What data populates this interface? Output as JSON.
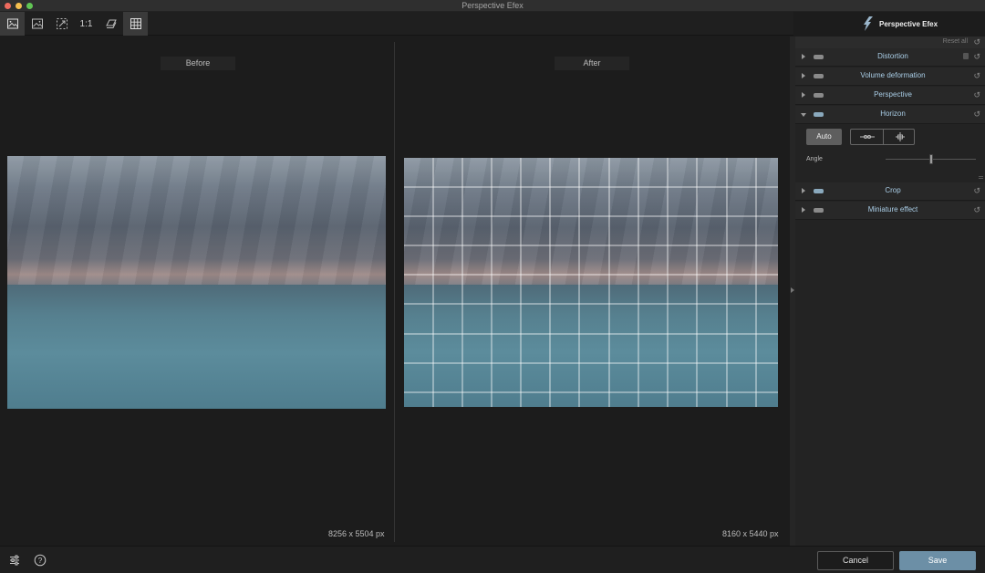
{
  "window": {
    "title": "Perspective Efex"
  },
  "toolbar": {
    "buttons": [
      {
        "icon": "single-view-icon",
        "active": true
      },
      {
        "icon": "image-view-icon",
        "active": false
      },
      {
        "icon": "fit-screen-icon",
        "active": false
      },
      {
        "icon": "actual-size-icon",
        "label": "1:1",
        "active": false
      },
      {
        "icon": "compare-layers-icon",
        "active": false
      },
      {
        "icon": "grid-icon",
        "active": true
      }
    ]
  },
  "brand": {
    "logo_icon": "perspective-efex-logo-icon",
    "name": "Perspective Efex"
  },
  "canvas": {
    "before": {
      "label": "Before",
      "dimensions": "8256 x 5504 px"
    },
    "after": {
      "label": "After",
      "dimensions": "8160 x 5440 px"
    }
  },
  "panel": {
    "reset_all": "Reset all",
    "sections": [
      {
        "title": "Distortion",
        "expanded": false,
        "locked": true
      },
      {
        "title": "Volume deformation",
        "expanded": false
      },
      {
        "title": "Perspective",
        "expanded": false
      },
      {
        "title": "Horizon",
        "expanded": true
      },
      {
        "title": "Crop",
        "expanded": false
      },
      {
        "title": "Miniature effect",
        "expanded": false
      }
    ],
    "horizon": {
      "auto_label": "Auto",
      "tools": [
        "horizon-line-tool-icon",
        "horizon-point-tool-icon"
      ],
      "angle_label": "Angle",
      "angle_slider_value": 0.5
    }
  },
  "bottom": {
    "settings_icon": "sliders-icon",
    "help_icon": "help-icon",
    "cancel_label": "Cancel",
    "save_label": "Save"
  },
  "colors": {
    "accent": "#6c8fa6",
    "section_title": "#a9cde6",
    "background": "#1c1c1c"
  }
}
